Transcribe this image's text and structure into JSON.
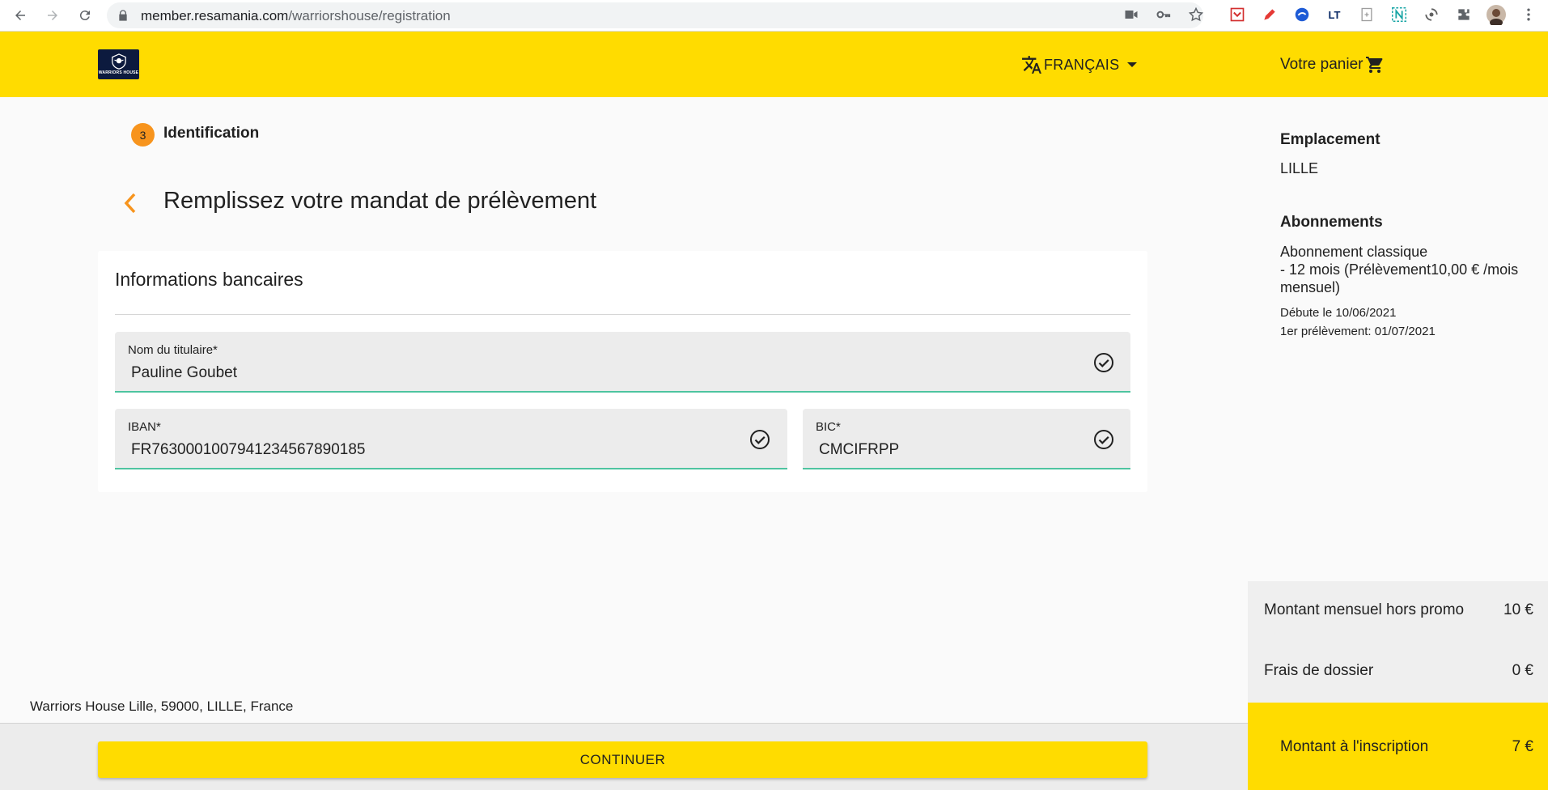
{
  "browser": {
    "url_host": "member.resamania.com",
    "url_path": "/warriorshouse/registration",
    "icons": [
      "back-icon",
      "forward-icon",
      "reload-icon",
      "lock-icon",
      "camera-icon",
      "key-icon",
      "star-icon",
      "profile-avatar",
      "menu-icon"
    ]
  },
  "header": {
    "logo_text": "WARRIORS HOUSE",
    "language": "FRANÇAIS",
    "cart_label": "Votre panier",
    "bg_color": "#ffdc00"
  },
  "step": {
    "number": "3",
    "label": "Identification",
    "badge_color": "#f7941d"
  },
  "page_title": "Remplissez votre mandat de prélèvement",
  "card": {
    "title": "Informations bancaires",
    "fields": {
      "holder": {
        "label": "Nom du titulaire",
        "required": "*",
        "value": "Pauline Goubet"
      },
      "iban": {
        "label": "IBAN",
        "required": "*",
        "value": "FR7630001007941234567890185"
      },
      "bic": {
        "label": "BIC",
        "required": "*",
        "value": "CMCIFRPP"
      }
    },
    "valid_color": "#4ec4a0"
  },
  "sidebar": {
    "location_heading": "Emplacement",
    "location_value": "LILLE",
    "subscriptions_heading": "Abonnements",
    "subscription_line1": "Abonnement classique",
    "subscription_line2": "- 12 mois (Prélèvement",
    "subscription_price": "10,00 € /mois",
    "subscription_line3": "mensuel)",
    "start_date": "Débute le 10/06/2021",
    "first_debit": "1er prélèvement: 01/07/2021"
  },
  "summary": {
    "monthly_label": "Montant mensuel hors promo",
    "monthly_value": "10 €",
    "fees_label": "Frais de dossier",
    "fees_value": "0 €",
    "total_label": "Montant à l'inscription",
    "total_value": "7 €"
  },
  "footer": {
    "address": "Warriors House Lille, 59000, LILLE, France",
    "continue_label": "CONTINUER"
  }
}
